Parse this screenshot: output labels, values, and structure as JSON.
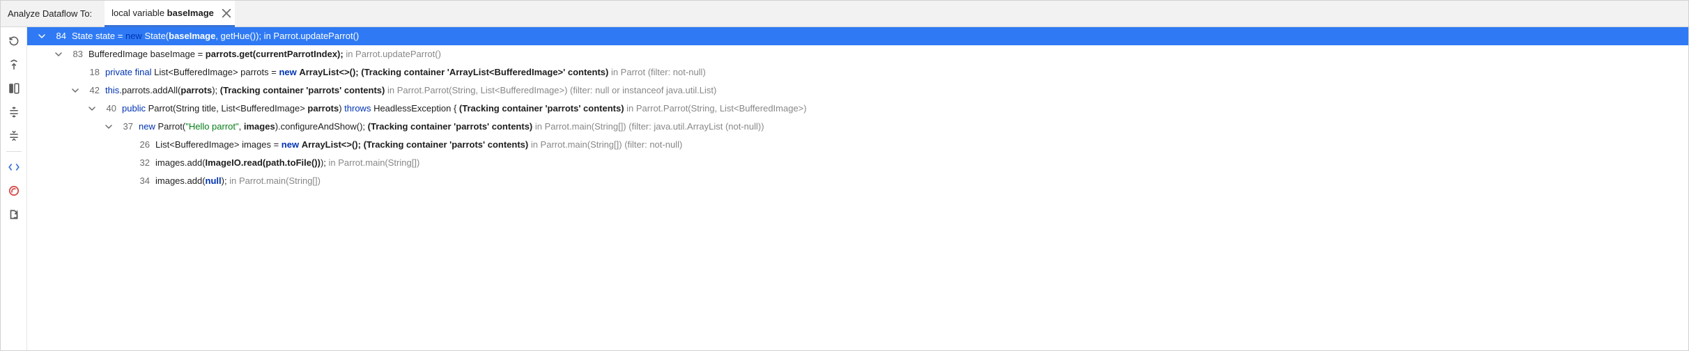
{
  "header": {
    "title": "Analyze Dataflow To:",
    "tab_prefix": "local variable ",
    "tab_bold": "baseImage"
  },
  "rows": [
    {
      "indent": 0,
      "caret": true,
      "selected": true,
      "ln": "84",
      "segs": [
        {
          "t": "State state = ",
          "cls": ""
        },
        {
          "t": "new",
          "cls": "kw"
        },
        {
          "t": " State(",
          "cls": ""
        },
        {
          "t": "baseImage",
          "cls": "b"
        },
        {
          "t": ", getHue()); in Parrot.updateParrot()",
          "cls": ""
        }
      ]
    },
    {
      "indent": 1,
      "caret": true,
      "ln": "83",
      "segs": [
        {
          "t": "BufferedImage baseImage = ",
          "cls": ""
        },
        {
          "t": "parrots.get(currentParrotIndex);",
          "cls": "b"
        },
        {
          "t": " in Parrot.updateParrot()",
          "cls": "ctx"
        }
      ]
    },
    {
      "indent": 2,
      "caret": false,
      "ln": "18",
      "segs": [
        {
          "t": "private final ",
          "cls": "kw"
        },
        {
          "t": "List<BufferedImage> parrots = ",
          "cls": ""
        },
        {
          "t": "new",
          "cls": "kw b"
        },
        {
          "t": " ",
          "cls": ""
        },
        {
          "t": "ArrayList<>();",
          "cls": "b"
        },
        {
          "t": " ",
          "cls": ""
        },
        {
          "t": "(Tracking container 'ArrayList<BufferedImage>' contents)",
          "cls": "b"
        },
        {
          "t": " in Parrot (filter: not-null)",
          "cls": "ctx"
        }
      ]
    },
    {
      "indent": 2,
      "caret": true,
      "ln": "42",
      "segs": [
        {
          "t": "this",
          "cls": "kw"
        },
        {
          "t": ".parrots.addAll(",
          "cls": ""
        },
        {
          "t": "parrots",
          "cls": "b"
        },
        {
          "t": "); ",
          "cls": ""
        },
        {
          "t": "(Tracking container 'parrots' contents)",
          "cls": "b"
        },
        {
          "t": " in Parrot.Parrot(String, List<BufferedImage>) (filter: null or instanceof java.util.List)",
          "cls": "ctx"
        }
      ]
    },
    {
      "indent": 3,
      "caret": true,
      "ln": "40",
      "segs": [
        {
          "t": "public ",
          "cls": "kw"
        },
        {
          "t": "Parrot(String title, List<BufferedImage> ",
          "cls": ""
        },
        {
          "t": "parrots",
          "cls": "b"
        },
        {
          "t": ") ",
          "cls": ""
        },
        {
          "t": "throws",
          "cls": "kw"
        },
        {
          "t": " HeadlessException { ",
          "cls": ""
        },
        {
          "t": "(Tracking container 'parrots' contents)",
          "cls": "b"
        },
        {
          "t": " in Parrot.Parrot(String, List<BufferedImage>)",
          "cls": "ctx"
        }
      ]
    },
    {
      "indent": 4,
      "caret": true,
      "ln": "37",
      "segs": [
        {
          "t": "new ",
          "cls": "kw"
        },
        {
          "t": "Parrot(",
          "cls": ""
        },
        {
          "t": "\"Hello parrot\"",
          "cls": "str"
        },
        {
          "t": ", ",
          "cls": ""
        },
        {
          "t": "images",
          "cls": "b"
        },
        {
          "t": ").configureAndShow(); ",
          "cls": ""
        },
        {
          "t": "(Tracking container 'parrots' contents)",
          "cls": "b"
        },
        {
          "t": " in Parrot.main(String[]) (filter: java.util.ArrayList (not-null))",
          "cls": "ctx"
        }
      ]
    },
    {
      "indent": 5,
      "caret": false,
      "ln": "26",
      "segs": [
        {
          "t": "List<BufferedImage> images = ",
          "cls": ""
        },
        {
          "t": "new",
          "cls": "kw b"
        },
        {
          "t": " ",
          "cls": ""
        },
        {
          "t": "ArrayList<>();",
          "cls": "b"
        },
        {
          "t": " ",
          "cls": ""
        },
        {
          "t": "(Tracking container 'parrots' contents)",
          "cls": "b"
        },
        {
          "t": " in Parrot.main(String[]) (filter: not-null)",
          "cls": "ctx"
        }
      ]
    },
    {
      "indent": 5,
      "caret": false,
      "ln": "32",
      "segs": [
        {
          "t": "images.add(",
          "cls": ""
        },
        {
          "t": "ImageIO.read(path.toFile())",
          "cls": "b"
        },
        {
          "t": "); ",
          "cls": ""
        },
        {
          "t": "in Parrot.main(String[])",
          "cls": "ctx"
        }
      ]
    },
    {
      "indent": 5,
      "caret": false,
      "ln": "34",
      "segs": [
        {
          "t": "images.add(",
          "cls": ""
        },
        {
          "t": "null",
          "cls": "kw b"
        },
        {
          "t": "); ",
          "cls": ""
        },
        {
          "t": "in Parrot.main(String[])",
          "cls": "ctx"
        }
      ]
    }
  ]
}
